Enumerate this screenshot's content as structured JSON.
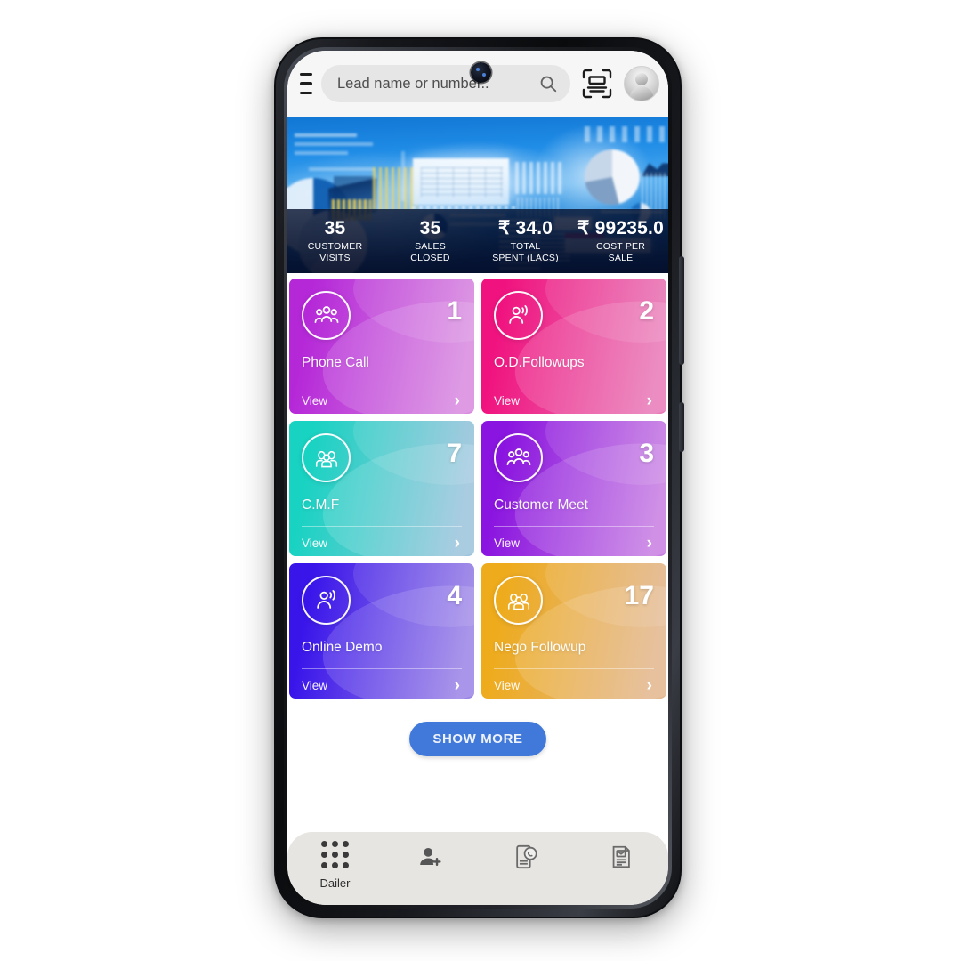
{
  "app": {
    "header": {
      "menu_icon": "hamburger-menu-icon",
      "search_placeholder": "Lead name or number..",
      "search_value": "",
      "search_icon": "search-icon",
      "scan_icon": "barcode-scan-icon",
      "avatar_icon": "user-avatar-icon"
    },
    "banner": {
      "alt": "business analytics dashboard banner",
      "stats": [
        {
          "value": "35",
          "label_line1": "CUSTOMER",
          "label_line2": "VISITS"
        },
        {
          "value": "35",
          "label_line1": "SALES",
          "label_line2": "CLOSED"
        },
        {
          "value": "₹ 34.0",
          "label_line1": "TOTAL",
          "label_line2": "SPENT (LACS)"
        },
        {
          "value": "₹ 99235.0",
          "label_line1": "COST PER",
          "label_line2": "SALE"
        }
      ]
    },
    "tiles": [
      {
        "title": "Phone Call",
        "count": "1",
        "view_label": "View",
        "icon": "people-group-icon",
        "color_from": "#b528d8",
        "color_to": "#d98be0",
        "chevron": "›"
      },
      {
        "title": "O.D.Followups",
        "count": "2",
        "view_label": "View",
        "icon": "person-broadcast-icon",
        "color_from": "#f0137f",
        "color_to": "#e87ab8",
        "chevron": "›"
      },
      {
        "title": "C.M.F",
        "count": "7",
        "view_label": "View",
        "icon": "family-group-icon",
        "color_from": "#18d3c2",
        "color_to": "#9dc4dd",
        "chevron": "›"
      },
      {
        "title": "Customer Meet",
        "count": "3",
        "view_label": "View",
        "icon": "people-group-icon",
        "color_from": "#8a14e0",
        "color_to": "#c77ee2",
        "chevron": "›"
      },
      {
        "title": "Online Demo",
        "count": "4",
        "view_label": "View",
        "icon": "person-broadcast-icon",
        "color_from": "#3a15ea",
        "color_to": "#9b84e6",
        "chevron": "›"
      },
      {
        "title": "Nego Followup",
        "count": "17",
        "view_label": "View",
        "icon": "family-group-icon",
        "color_from": "#eeab1c",
        "color_to": "#e3b78f",
        "chevron": "›"
      }
    ],
    "show_more": {
      "label": "SHOW MORE",
      "color": "#4079da"
    },
    "bottom_nav": [
      {
        "label": "Dailer",
        "icon": "dialpad-icon"
      },
      {
        "label": "",
        "icon": "add-contact-icon"
      },
      {
        "label": "",
        "icon": "mobile-whatsapp-icon"
      },
      {
        "label": "",
        "icon": "document-report-icon"
      }
    ]
  }
}
